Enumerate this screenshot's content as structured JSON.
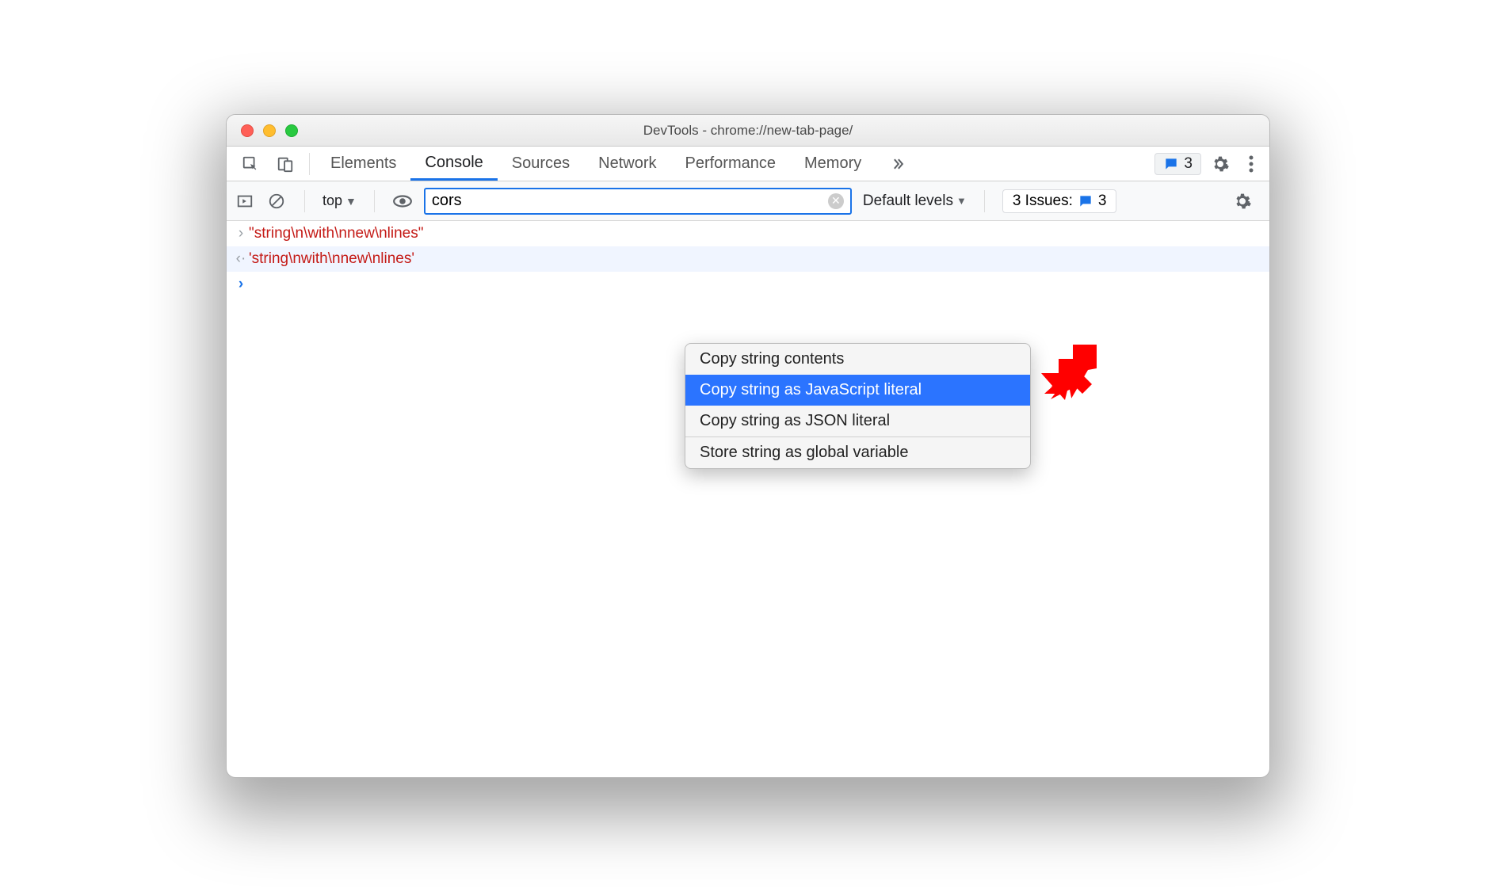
{
  "window": {
    "title": "DevTools - chrome://new-tab-page/"
  },
  "tabs": {
    "items": [
      "Elements",
      "Console",
      "Sources",
      "Network",
      "Performance",
      "Memory"
    ],
    "active_index": 1,
    "messages_count": "3"
  },
  "toolbar": {
    "context": "top",
    "filter_value": "cors",
    "levels": "Default levels",
    "issues_label": "3 Issues:",
    "issues_count": "3"
  },
  "console_lines": {
    "input": "\"string\\n\\with\\nnew\\nlines\"",
    "output": "'string\\nwith\\nnew\\nlines'"
  },
  "context_menu": {
    "copy_contents": "Copy string contents",
    "copy_js": "Copy string as JavaScript literal",
    "copy_json": "Copy string as JSON literal",
    "store_global": "Store string as global variable",
    "selected_index": 1
  }
}
